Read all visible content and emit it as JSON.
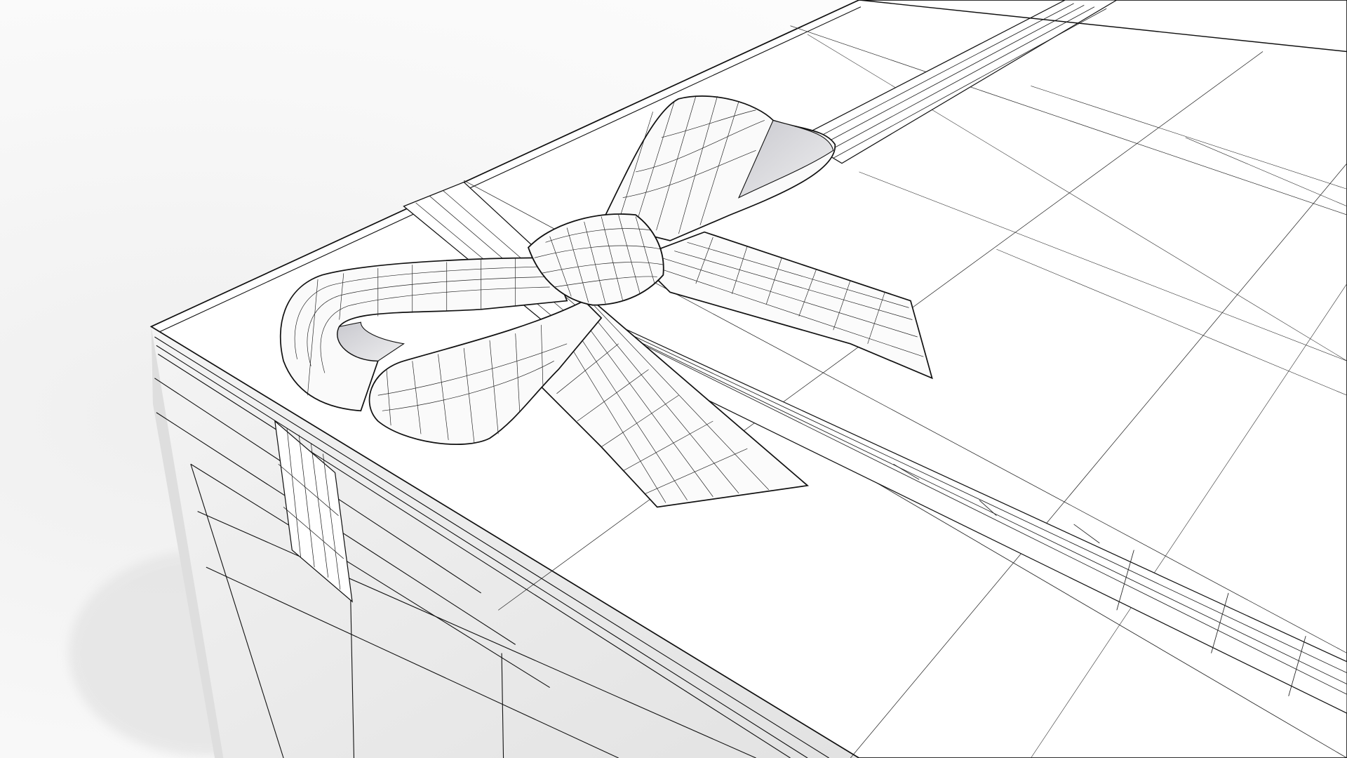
{
  "scene": {
    "subject": "gift-box-wireframe-render",
    "colors": {
      "background": "#ffffff",
      "background_shadow": "#ececec",
      "lid_top": "#ffffff",
      "lid_side": "#f2f2f2",
      "box_side": "#e6e6e6",
      "ribbon": "#f7f7f7",
      "ribbon_inner": "#d9d9dc",
      "wire": "#111111",
      "wire_light": "#555555"
    }
  }
}
